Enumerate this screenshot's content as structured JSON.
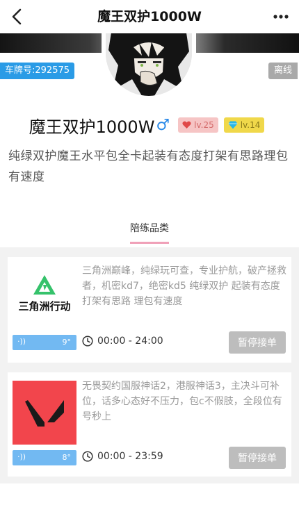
{
  "nav": {
    "title": "魔王双护1000W"
  },
  "profile": {
    "plate_label": "车牌号:292575",
    "status": "离线",
    "name": "魔王双护1000W",
    "gender_symbol": "♂",
    "level_heart": "lv.25",
    "level_diamond": "lv.14",
    "bio": "纯绿双护魔王水平包全卡起装有态度打架有思路理包有速度"
  },
  "tab": {
    "label": "陪练品类"
  },
  "cards": [
    {
      "game_logo_text": "三角洲行动",
      "description": "三角洲巅峰，纯绿玩可查，专业护航，破产拯救者，机密kd7，绝密kd5 纯绿双护 起装有态度 打架有思路 理包有速度",
      "score": "9°",
      "time": "00:00 - 24:00",
      "button": "暂停接单"
    },
    {
      "game_logo_text": "",
      "description": "无畏契约国服神话2，港服神话3，主决斗可补位，话多心态好不压力，包c不假肢，全段位有号秒上",
      "score": "8°",
      "time": "00:00 - 23:59",
      "button": "暂停接单"
    }
  ],
  "colors": {
    "accent_blue": "#2a9be6",
    "offline_gray": "#a9a9a9",
    "tab_underline": "#f0a0b8",
    "valorant_red": "#f2454c",
    "delta_green": "#35c26b"
  }
}
